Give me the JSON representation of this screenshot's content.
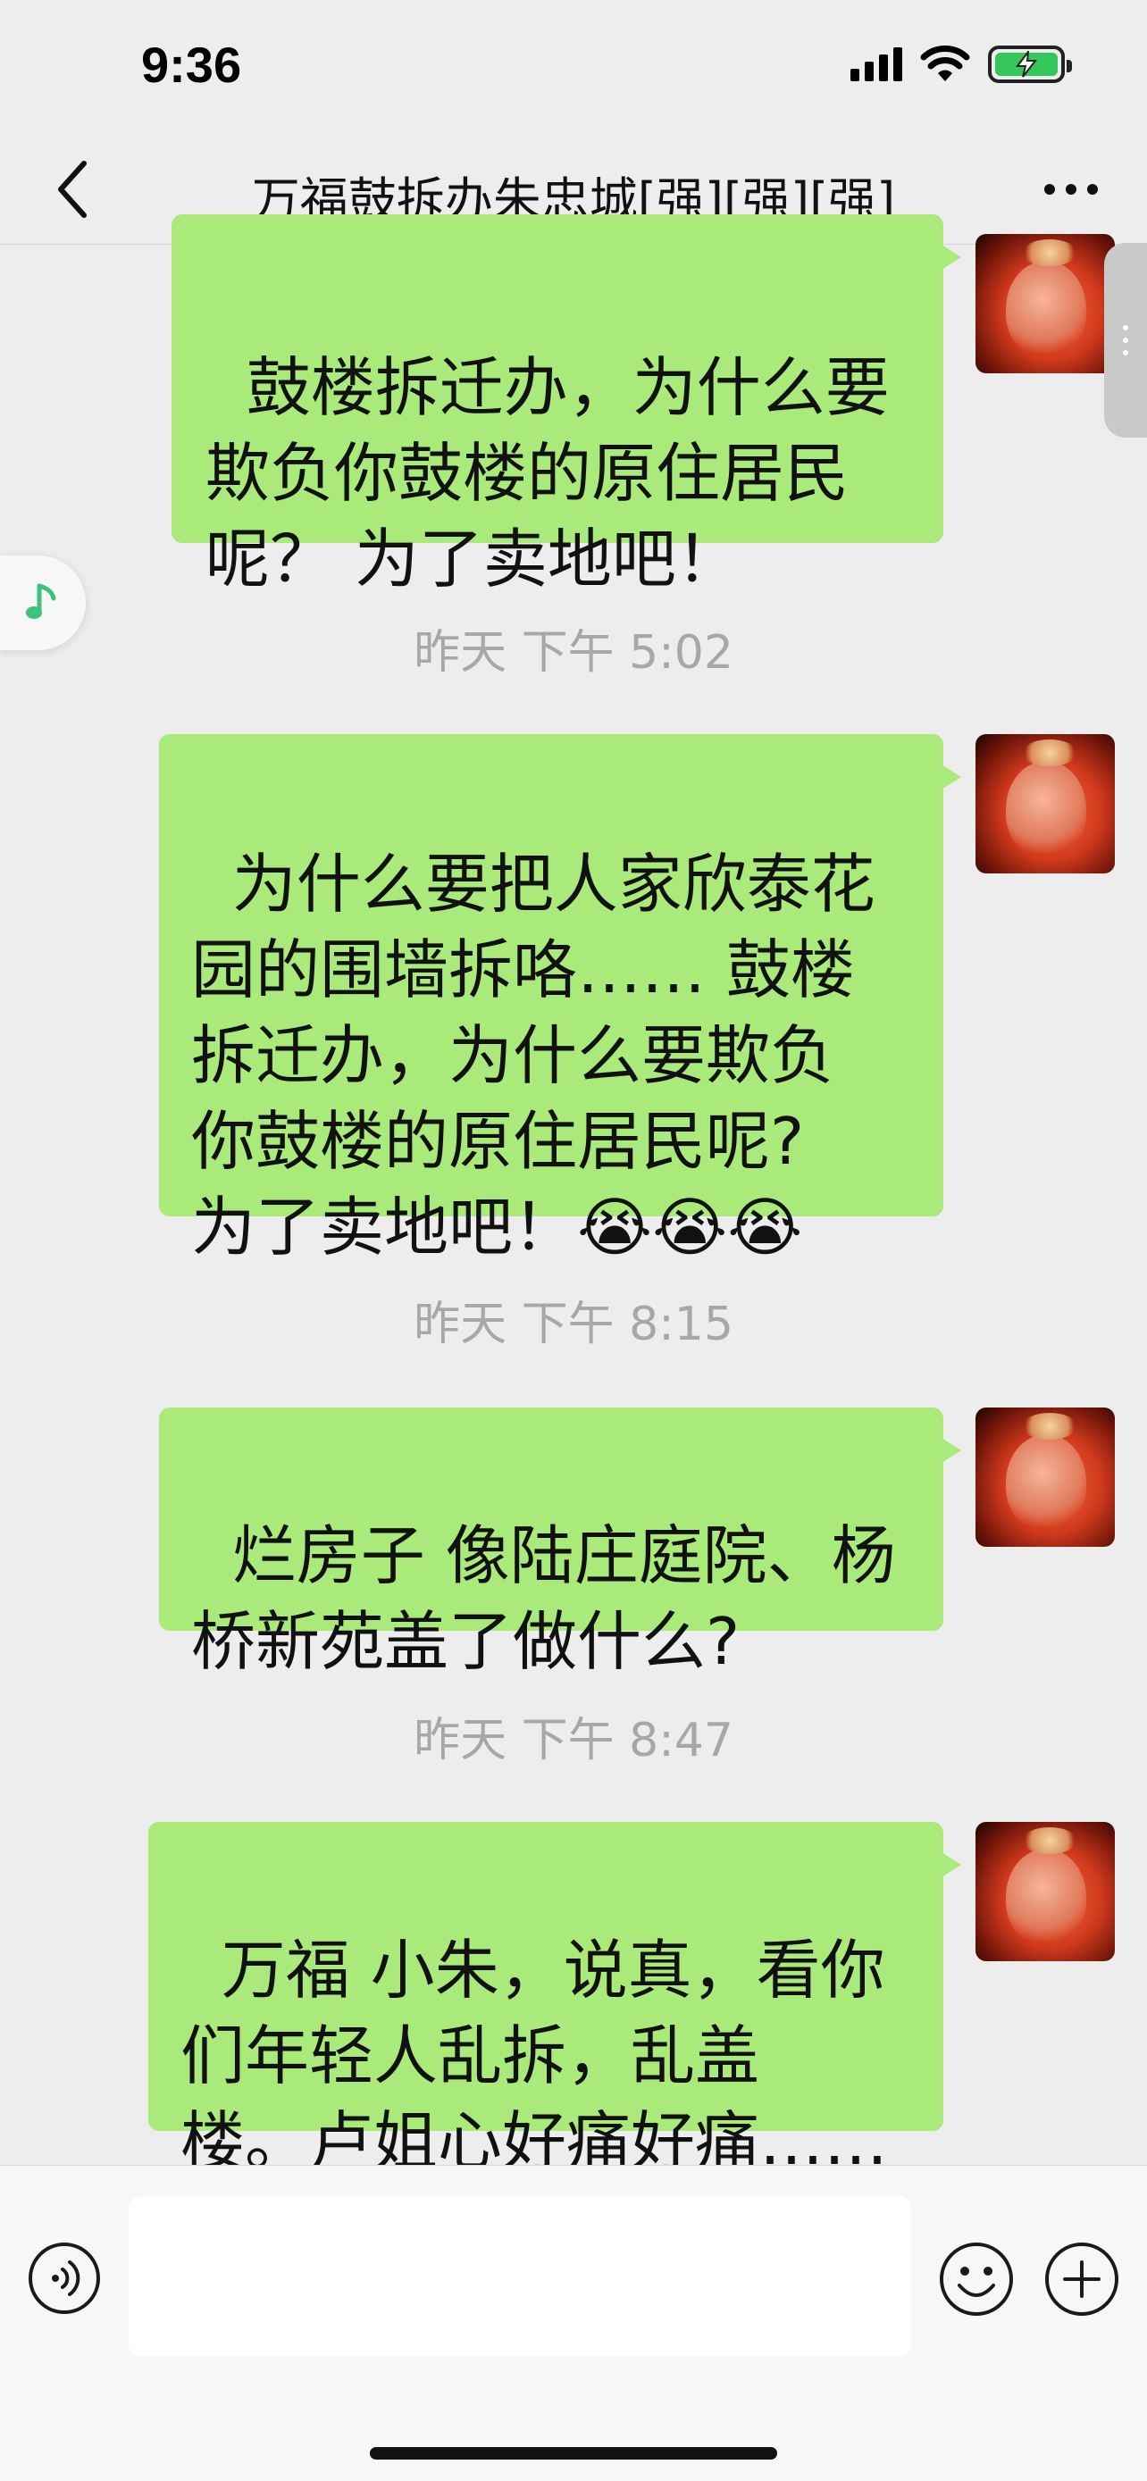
{
  "status_bar": {
    "time": "9:36",
    "icons": [
      "cellular-signal-icon",
      "wifi-icon",
      "battery-charging-icon"
    ]
  },
  "header": {
    "title": "万福鼓拆办朱忠城[强][强][强]",
    "back_icon": "chevron-left-icon",
    "more_icon": "more-dots-icon"
  },
  "messages": [
    {
      "sender": "self",
      "text": "鼓楼拆迁办，为什么要\n欺负你鼓楼的原住居民\n呢？ 为了卖地吧！"
    },
    {
      "timestamp": "昨天 下午 5:02"
    },
    {
      "sender": "self",
      "text": "为什么要把人家欣泰花\n园的围墙拆咯…… 鼓楼\n拆迁办，为什么要欺负\n你鼓楼的原住居民呢?\n为了卖地吧！😭😭😭"
    },
    {
      "timestamp": "昨天 下午 8:15"
    },
    {
      "sender": "self",
      "text": "烂房子 像陆庄庭院、杨\n桥新苑盖了做什么?"
    },
    {
      "timestamp": "昨天 下午 8:47"
    },
    {
      "sender": "self",
      "text": "万福 小朱，说真，看你\n们年轻人乱拆，乱盖\n楼。卢姐心好痛好痛……"
    }
  ],
  "floating": {
    "music_icon": "music-note-icon",
    "side_handle_icon": "drag-handle-icon"
  },
  "input_bar": {
    "voice_icon": "voice-input-icon",
    "input_value": "",
    "emoji_icon": "emoji-icon",
    "plus_icon": "plus-icon"
  },
  "colors": {
    "background": "#ededed",
    "bubble_self": "#a9ea7a",
    "timestamp_text": "#a7a7a7",
    "battery_fill": "#35c759"
  }
}
